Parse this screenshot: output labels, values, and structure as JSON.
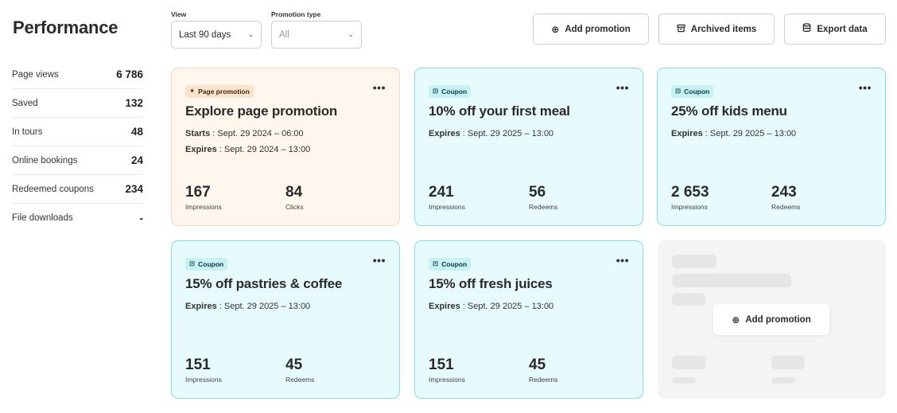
{
  "page": {
    "title": "Performance"
  },
  "stats": [
    {
      "label": "Page views",
      "value": "6 786"
    },
    {
      "label": "Saved",
      "value": "132"
    },
    {
      "label": "In tours",
      "value": "48"
    },
    {
      "label": "Online bookings",
      "value": "24"
    },
    {
      "label": "Redeemed coupons",
      "value": "234"
    },
    {
      "label": "File downloads",
      "value": "-"
    }
  ],
  "filters": {
    "view": {
      "label": "View",
      "value": "Last 90 days"
    },
    "promotion_type": {
      "label": "Promotion type",
      "value": "All"
    }
  },
  "toolbar": {
    "add_promotion": "Add promotion",
    "archived_items": "Archived items",
    "export_data": "Export data"
  },
  "cards": [
    {
      "badge": "Page promotion",
      "title": "Explore page promotion",
      "starts_label": "Starts",
      "starts": " : Sept. 29 2024 – 06:00",
      "expires_label": "Expires",
      "expires": " : Sept. 29 2024 – 13:00",
      "metric1_value": "167",
      "metric1_label": "Impressions",
      "metric2_value": "84",
      "metric2_label": "Clicks"
    },
    {
      "badge": "Coupon",
      "title": "10% off your first meal",
      "expires_label": "Expires",
      "expires": " : Sept. 29 2025 – 13:00",
      "metric1_value": "241",
      "metric1_label": "Impressions",
      "metric2_value": "56",
      "metric2_label": "Redeems"
    },
    {
      "badge": "Coupon",
      "title": "25% off kids menu",
      "expires_label": "Expires",
      "expires": " : Sept. 29 2025 – 13:00",
      "metric1_value": "2 653",
      "metric1_label": "Impressions",
      "metric2_value": "243",
      "metric2_label": "Redeems"
    },
    {
      "badge": "Coupon",
      "title": "15% off pastries & coffee",
      "expires_label": "Expires",
      "expires": " : Sept. 29 2025 – 13:00",
      "metric1_value": "151",
      "metric1_label": "Impressions",
      "metric2_value": "45",
      "metric2_label": "Redeems"
    },
    {
      "badge": "Coupon",
      "title": "15% off fresh juices",
      "expires_label": "Expires",
      "expires": " : Sept. 29 2025 – 13:00",
      "metric1_value": "151",
      "metric1_label": "Impressions",
      "metric2_value": "45",
      "metric2_label": "Redeems"
    }
  ],
  "empty_card": {
    "add_label": "Add promotion"
  },
  "icons": {
    "add": "plus-circle-icon",
    "archive": "archive-box-icon",
    "export": "database-icon",
    "sparkle": "sparkle-icon",
    "coupon": "ticket-icon",
    "more": "more-horizontal-icon",
    "chevron": "chevron-down-icon"
  },
  "colors": {
    "page_card_bg": "#fff6ee",
    "page_card_border": "#f4d5bd",
    "coupon_card_bg": "#e7fafc",
    "coupon_card_border": "#84dfe4",
    "coupon_badge_bg": "#c6f2f4",
    "page_badge_bg": "#fde2cc"
  }
}
